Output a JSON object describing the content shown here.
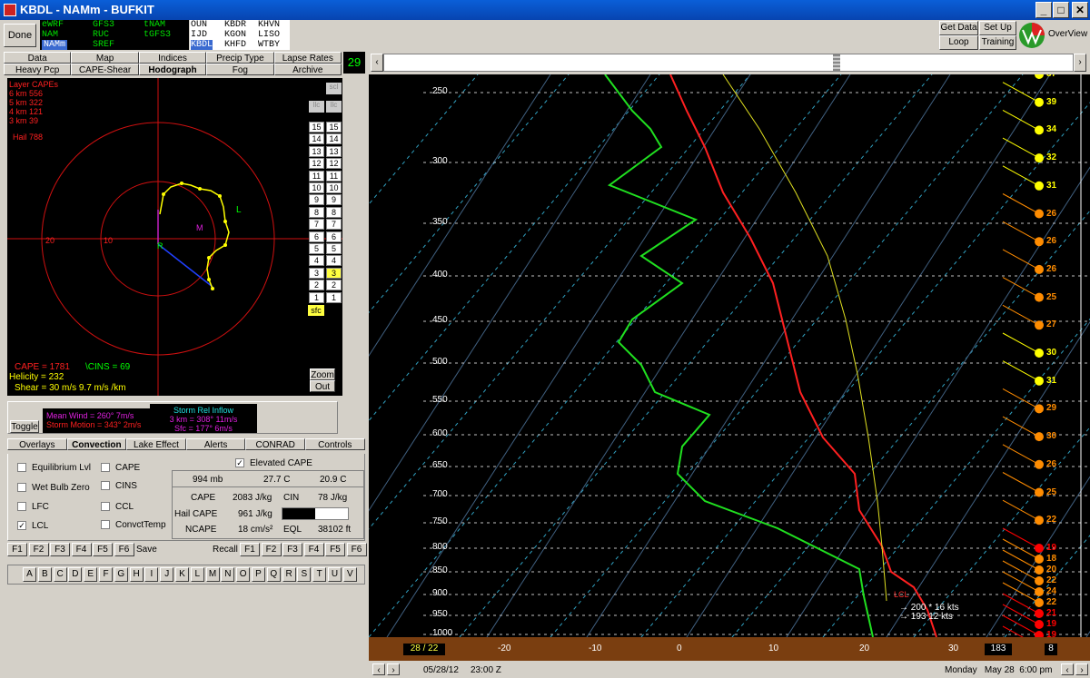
{
  "window": {
    "title": "KBDL - NAMm - BUFKIT",
    "min": "_",
    "max": "□",
    "close": "✕"
  },
  "toolbar": {
    "done": "Done",
    "models": [
      [
        "eWRF",
        "GFS3",
        "tNAM"
      ],
      [
        "NAM",
        "RUC",
        "tGFS3"
      ],
      [
        "NAMm",
        "SREF",
        ""
      ]
    ],
    "stations": [
      [
        "OUN",
        "KBDR",
        "KHVN"
      ],
      [
        "IJD",
        "KGON",
        "LISO"
      ],
      [
        "KBDL",
        "KHFD",
        "WTBY"
      ]
    ],
    "getdata": "Get Data",
    "setup": "Set Up",
    "loop": "Loop",
    "training": "Training",
    "overview": "OverView"
  },
  "tabs1": [
    "Data",
    "Map",
    "Indices",
    "Precip Type",
    "Lapse Rates"
  ],
  "tabs2": [
    "Heavy Pcp",
    "CAPE-Shear",
    "Hodograph",
    "Fog",
    "Archive"
  ],
  "frame_count": "29",
  "hodo": {
    "cape_title": "Layer CAPEs",
    "layers": [
      "6 km  556",
      "5 km  322",
      "4 km  121",
      "3 km  39"
    ],
    "hail": "Hail  788",
    "ring20": "20",
    "ring10": "10",
    "L": "L",
    "M": "M",
    "R": "R",
    "cape_line": "CAPE = 1781",
    "cins_line": "\\CINS = 69",
    "helicity": "Helicity = 232",
    "shear": "Shear = 30 m/s   9.7 m/s /km",
    "zoom": "Zoom",
    "out": "Out",
    "scl": "scl",
    "llc1": "llc",
    "llc2": "llc",
    "sfc": "sfc",
    "levels": [
      "15",
      "14",
      "13",
      "12",
      "11",
      "10",
      "9",
      "8",
      "7",
      "6",
      "5",
      "4",
      "3",
      "2",
      "1"
    ]
  },
  "toggle": "Toggle",
  "meanwind": {
    "mean": "Mean Wind = 260° 7m/s",
    "motion": "Storm Motion = 343° 2m/s"
  },
  "inflow": {
    "title": "Storm Rel Inflow",
    "km3": "3 km = 308° 11m/s",
    "sfc": "Sfc = 177° 6m/s"
  },
  "tabs3": [
    "Overlays",
    "Convection",
    "Lake Effect",
    "Alerts",
    "CONRAD",
    "Controls"
  ],
  "checks": {
    "eq": "Equilibrium Lvl",
    "wbz": "Wet Bulb Zero",
    "lfc": "LFC",
    "lcl": "LCL",
    "cape": "CAPE",
    "cins": "CINS",
    "ccl": "CCL",
    "ct": "ConvctTemp",
    "elev": "Elevated CAPE"
  },
  "stats": {
    "p": "994 mb",
    "t": "27.7 C",
    "td": "20.9 C",
    "cape_l": "CAPE",
    "cape_v": "2083 J/kg",
    "cin_l": "CIN",
    "cin_v": "78 J/kg",
    "hail_l": "Hail CAPE",
    "hail_v": "961 J/kg",
    "ncape_l": "NCAPE",
    "ncape_v": "18 cm/s²",
    "eql_l": "EQL",
    "eql_v": "38102 ft"
  },
  "fkeys": [
    "F1",
    "F2",
    "F3",
    "F4",
    "F5",
    "F6"
  ],
  "save": "Save",
  "recall": "Recall",
  "letters": [
    "A",
    "B",
    "C",
    "D",
    "E",
    "F",
    "G",
    "H",
    "I",
    "J",
    "K",
    "L",
    "M",
    "N",
    "O",
    "P",
    "Q",
    "R",
    "S",
    "T",
    "U",
    "V"
  ],
  "skewt": {
    "pressures": [
      "250",
      "300",
      "350",
      "400",
      "450",
      "500",
      "550",
      "600",
      "650",
      "700",
      "750",
      "800",
      "850",
      "900",
      "950",
      "1000"
    ],
    "temps": [
      "-20",
      "-10",
      "0",
      "10",
      "20",
      "30"
    ],
    "winds": [
      "37",
      "39",
      "34",
      "32",
      "31",
      "26",
      "26",
      "26",
      "25",
      "27",
      "30",
      "31",
      "29",
      "30",
      "26",
      "25",
      "22",
      "19",
      "18",
      "20",
      "22",
      "24",
      "22",
      "21",
      "19",
      "19",
      "16",
      "7"
    ],
    "bottom_left": "28 / 22",
    "bottom_right": "183",
    "bottom_8": "8",
    "annot1": "200 * 16 kts",
    "annot2": "193  12 kts",
    "lcl": "LCL"
  },
  "status": {
    "date": "05/28/12",
    "time": "23:00 Z",
    "local": "Monday   May 28  6:00 pm"
  }
}
